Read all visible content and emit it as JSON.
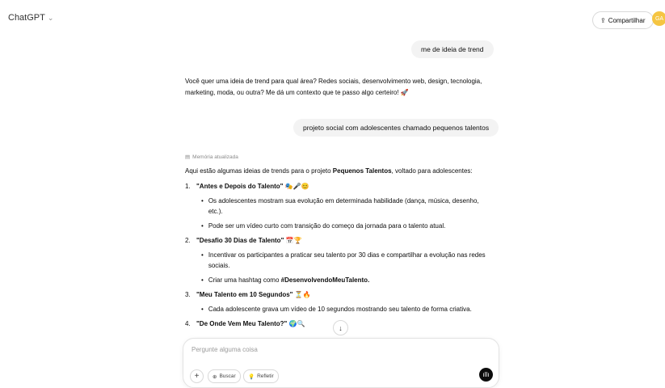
{
  "header": {
    "model_name": "ChatGPT",
    "share_label": "Compartilhar",
    "avatar_initials": "GA"
  },
  "messages": {
    "user1": "me de ideia de trend",
    "assistant1": "Você quer uma ideia de trend para qual área? Redes sociais, desenvolvimento web, design, tecnologia, marketing, moda, ou outra? Me dá um contexto que te passo algo certeiro! 🚀",
    "user2": "projeto social com adolescentes chamado pequenos talentos",
    "memory_label": "Memória atualizada",
    "intro_prefix": "Aqui estão algumas ideias de trends para o projeto ",
    "intro_bold": "Pequenos Talentos",
    "intro_suffix": ", voltado para adolescentes:",
    "items": [
      {
        "num": "1.",
        "title": "\"Antes e Depois do Talento\" 🎭🎤😊",
        "bullets": [
          "Os adolescentes mostram sua evolução em determinada habilidade (dança, música, desenho, etc.).",
          "Pode ser um vídeo curto com transição do começo da jornada para o talento atual."
        ]
      },
      {
        "num": "2.",
        "title": "\"Desafio 30 Dias de Talento\" 📅🏆",
        "bullets": [
          "Incentivar os participantes a praticar seu talento por 30 dias e compartilhar a evolução nas redes sociais.",
          "Criar uma hashtag como #DesenvolvendoMeuTalento."
        ]
      },
      {
        "num": "3.",
        "title": "\"Meu Talento em 10 Segundos\" ⏳🔥",
        "bullets": [
          "Cada adolescente grava um vídeo de 10 segundos mostrando seu talento de forma criativa."
        ]
      },
      {
        "num": "4.",
        "title": "\"De Onde Vem Meu Talento?\" 🌍🔍",
        "bullets": []
      }
    ],
    "hashtag_prefix": "Criar uma hashtag como ",
    "hashtag_bold": "#DesenvolvendoMeuTalento."
  },
  "composer": {
    "placeholder": "Pergunte alguma coisa",
    "search_label": "Buscar",
    "reason_label": "Refletir"
  },
  "icons": {
    "chevron": "chevron-down-icon",
    "share": "share-icon",
    "memory": "memory-icon",
    "scroll": "arrow-down-icon",
    "plus": "plus-icon",
    "globe": "globe-icon",
    "bulb": "lightbulb-icon",
    "voice": "voice-icon"
  }
}
